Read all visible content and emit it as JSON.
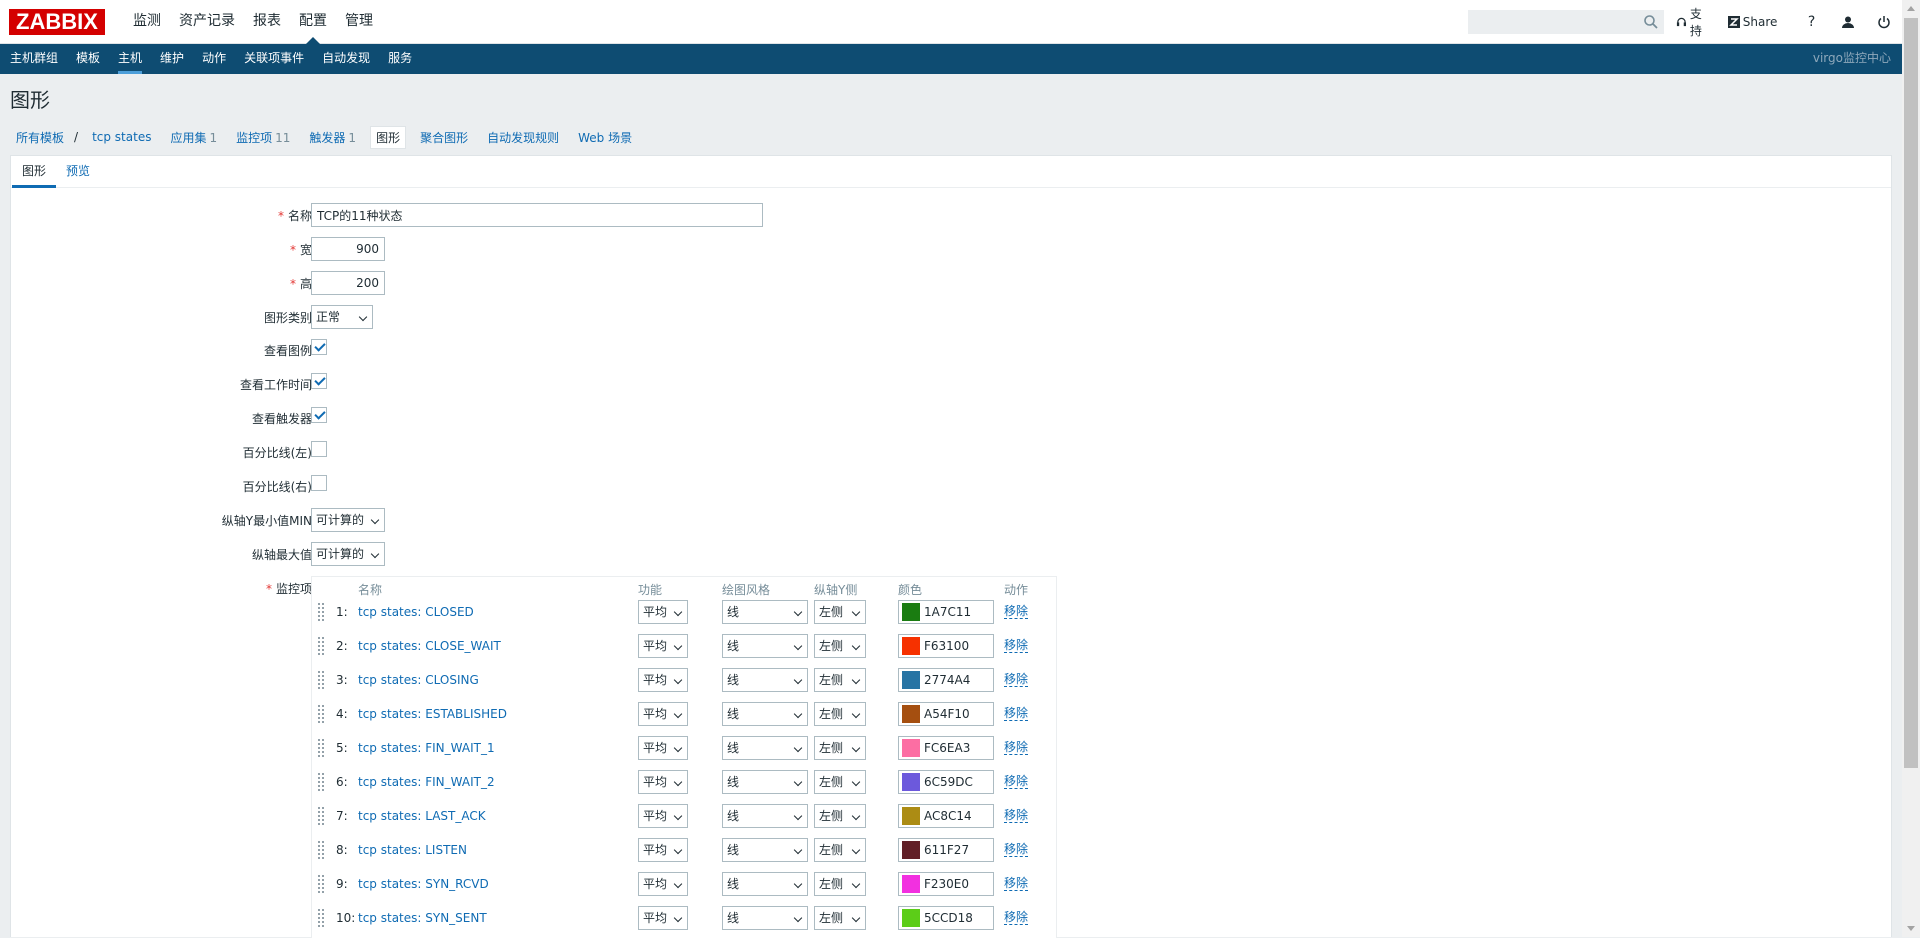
{
  "header": {
    "logo": "ZABBIX",
    "nav": [
      "监测",
      "资产记录",
      "报表",
      "配置",
      "管理"
    ],
    "active_nav": 3,
    "search_placeholder": "",
    "support_label": "支持",
    "share_label": "Share",
    "help_label": "?"
  },
  "subnav": {
    "items": [
      "主机群组",
      "模板",
      "主机",
      "维护",
      "动作",
      "关联项事件",
      "自动发现",
      "服务"
    ],
    "active": 2,
    "right_label": "virgo监控中心"
  },
  "page_title": "图形",
  "breadcrumbs": {
    "all_templates": "所有模板",
    "template": "tcp states",
    "apps": "应用集",
    "apps_count": "1",
    "items": "监控项",
    "items_count": "11",
    "triggers": "触发器",
    "triggers_count": "1",
    "graphs": "图形",
    "screens": "聚合图形",
    "discovery": "自动发现规则",
    "web": "Web 场景"
  },
  "tabs": [
    "图形",
    "预览"
  ],
  "form": {
    "name_label": "名称",
    "name_value": "TCP的11种状态",
    "width_label": "宽",
    "width_value": "900",
    "height_label": "高",
    "height_value": "200",
    "type_label": "图形类别",
    "type_value": "正常",
    "show_legend_label": "查看图例",
    "show_legend": true,
    "show_worktime_label": "查看工作时间",
    "show_worktime": true,
    "show_triggers_label": "查看触发器",
    "show_triggers": true,
    "percentile_left_label": "百分比线(左)",
    "percentile_left": false,
    "percentile_right_label": "百分比线(右)",
    "percentile_right": false,
    "ymin_label": "纵轴Y最小值MIN",
    "ymin_value": "可计算的",
    "ymax_label": "纵轴最大值",
    "ymax_value": "可计算的",
    "items_label": "监控项"
  },
  "items_table": {
    "headers": {
      "name": "名称",
      "function": "功能",
      "style": "绘图风格",
      "yaxis": "纵轴Y侧",
      "color": "颜色",
      "action": "动作"
    },
    "rows": [
      {
        "idx": "1:",
        "name": "tcp states: CLOSED",
        "function": "平均",
        "style": "线",
        "yaxis": "左侧",
        "color": "1A7C11",
        "action": "移除"
      },
      {
        "idx": "2:",
        "name": "tcp states: CLOSE_WAIT",
        "function": "平均",
        "style": "线",
        "yaxis": "左侧",
        "color": "F63100",
        "action": "移除"
      },
      {
        "idx": "3:",
        "name": "tcp states: CLOSING",
        "function": "平均",
        "style": "线",
        "yaxis": "左侧",
        "color": "2774A4",
        "action": "移除"
      },
      {
        "idx": "4:",
        "name": "tcp states: ESTABLISHED",
        "function": "平均",
        "style": "线",
        "yaxis": "左侧",
        "color": "A54F10",
        "action": "移除"
      },
      {
        "idx": "5:",
        "name": "tcp states: FIN_WAIT_1",
        "function": "平均",
        "style": "线",
        "yaxis": "左侧",
        "color": "FC6EA3",
        "action": "移除"
      },
      {
        "idx": "6:",
        "name": "tcp states: FIN_WAIT_2",
        "function": "平均",
        "style": "线",
        "yaxis": "左侧",
        "color": "6C59DC",
        "action": "移除"
      },
      {
        "idx": "7:",
        "name": "tcp states: LAST_ACK",
        "function": "平均",
        "style": "线",
        "yaxis": "左侧",
        "color": "AC8C14",
        "action": "移除"
      },
      {
        "idx": "8:",
        "name": "tcp states: LISTEN",
        "function": "平均",
        "style": "线",
        "yaxis": "左侧",
        "color": "611F27",
        "action": "移除"
      },
      {
        "idx": "9:",
        "name": "tcp states: SYN_RCVD",
        "function": "平均",
        "style": "线",
        "yaxis": "左侧",
        "color": "F230E0",
        "action": "移除"
      },
      {
        "idx": "10:",
        "name": "tcp states: SYN_SENT",
        "function": "平均",
        "style": "线",
        "yaxis": "左侧",
        "color": "5CCD18",
        "action": "移除"
      }
    ]
  },
  "colors": {
    "brand_red": "#d40000",
    "nav_blue": "#0e4c72",
    "link_blue": "#0f6bb3",
    "required_red": "#e33734"
  }
}
